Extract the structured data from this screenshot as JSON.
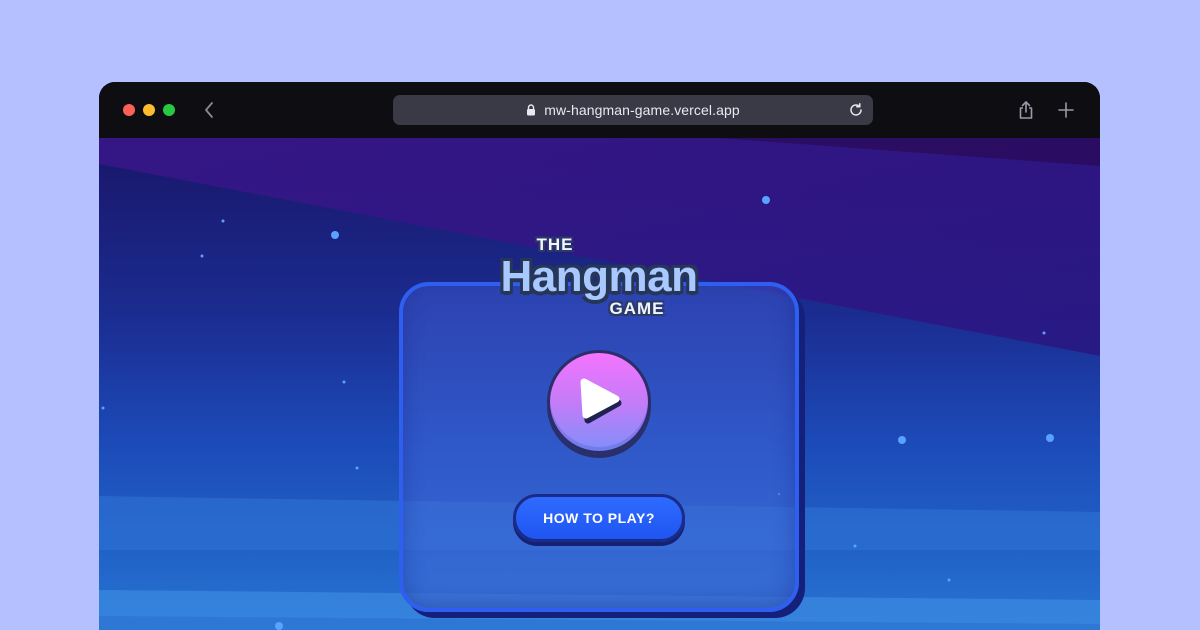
{
  "browser": {
    "url": "mw-hangman-game.vercel.app"
  },
  "game": {
    "logo": {
      "the": "THE",
      "title": "Hangman",
      "game": "GAME"
    },
    "howto_label": "HOW TO PLAY?"
  },
  "icons": {
    "back": "chevron-left-icon",
    "lock": "lock-icon",
    "reload": "reload-icon",
    "share": "share-icon",
    "new_tab": "plus-icon",
    "play": "play-icon"
  },
  "colors": {
    "page_background": "#b4c0ff",
    "toolbar": "#0e0e12",
    "url_bar": "#393a46",
    "play_button_top": "#f573ff",
    "play_button_bottom": "#7f8ffa",
    "howto_button": "#2f6bff",
    "card_border": "#2e5ff0"
  }
}
